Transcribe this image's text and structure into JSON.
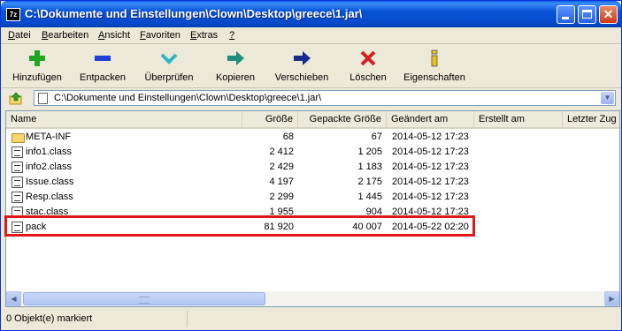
{
  "window": {
    "title": "C:\\Dokumente und Einstellungen\\Clown\\Desktop\\greece\\1.jar\\",
    "app_icon_text": "7z",
    "close_glyph": "✕"
  },
  "menu": [
    "Datei",
    "Bearbeiten",
    "Ansicht",
    "Favoriten",
    "Extras",
    "?"
  ],
  "menu_underline": [
    "D",
    "B",
    "A",
    "F",
    "E",
    "?"
  ],
  "toolbar": {
    "buttons": [
      {
        "label": "Hinzufügen",
        "icon": "plus-icon",
        "color": "#1fa81f"
      },
      {
        "label": "Entpacken",
        "icon": "minus-icon",
        "color": "#1f3fd6"
      },
      {
        "label": "Überprüfen",
        "icon": "check-icon",
        "color": "#2fb7c9"
      },
      {
        "label": "Kopieren",
        "icon": "copy-arrow-icon",
        "color": "#1e8d7e"
      },
      {
        "label": "Verschieben",
        "icon": "move-arrow-icon",
        "color": "#1a2a8c"
      },
      {
        "label": "Löschen",
        "icon": "delete-x-icon",
        "color": "#d42020"
      },
      {
        "label": "Eigenschaften",
        "icon": "info-icon",
        "color": "#e8c21c"
      }
    ]
  },
  "address": {
    "path": "C:\\Dokumente und Einstellungen\\Clown\\Desktop\\greece\\1.jar\\",
    "dropdown_glyph": "▼"
  },
  "columns": [
    "Name",
    "Größe",
    "Gepackte Größe",
    "Geändert am",
    "Erstellt am",
    "Letzter Zug"
  ],
  "files": [
    {
      "name": "META-INF",
      "size": "68",
      "packed": "67",
      "modified": "2014-05-12 17:23",
      "type": "folder"
    },
    {
      "name": "info1.class",
      "size": "2 412",
      "packed": "1 205",
      "modified": "2014-05-12 17:23",
      "type": "class"
    },
    {
      "name": "info2.class",
      "size": "2 429",
      "packed": "1 183",
      "modified": "2014-05-12 17:23",
      "type": "class"
    },
    {
      "name": "Issue.class",
      "size": "4 197",
      "packed": "2 175",
      "modified": "2014-05-12 17:23",
      "type": "class"
    },
    {
      "name": "Resp.class",
      "size": "2 299",
      "packed": "1 445",
      "modified": "2014-05-12 17:23",
      "type": "class"
    },
    {
      "name": "stac.class",
      "size": "1 955",
      "packed": "904",
      "modified": "2014-05-12 17:23",
      "type": "class"
    },
    {
      "name": "pack",
      "size": "81 920",
      "packed": "40 007",
      "modified": "2014-05-22 02:20",
      "type": "class"
    }
  ],
  "scrollbar": {
    "left_glyph": "◀",
    "right_glyph": "▶"
  },
  "status": {
    "text": "0 Objekt(e) markiert"
  },
  "colors": {
    "highlight_box": "#e01818",
    "titlebar": "#0754d8"
  }
}
